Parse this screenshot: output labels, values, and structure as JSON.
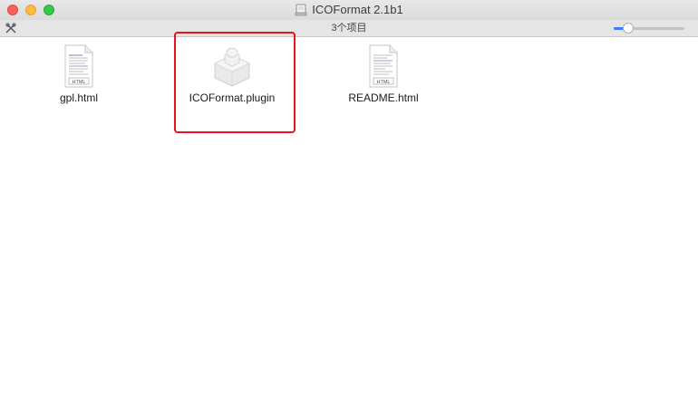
{
  "window": {
    "title": "ICOFormat 2.1b1",
    "title_icon": "disk-image-icon",
    "traffic_lights": {
      "close_color": "#fc605b",
      "minimize_color": "#fdbc40",
      "maximize_color": "#34c84a"
    }
  },
  "statusbar": {
    "item_count": "3个项目",
    "tools_icon": "tools-icon",
    "icon_size_slider_value": 0.15
  },
  "files": [
    {
      "name": "gpl.html",
      "icon": "html-document-icon",
      "badge": "HTML"
    },
    {
      "name": "ICOFormat.plugin",
      "icon": "plugin-bundle-icon",
      "selected": true
    },
    {
      "name": "README.html",
      "icon": "html-document-icon",
      "badge": "HTML"
    }
  ],
  "annotation": {
    "color": "#e6161c",
    "target": "ICOFormat.plugin"
  }
}
